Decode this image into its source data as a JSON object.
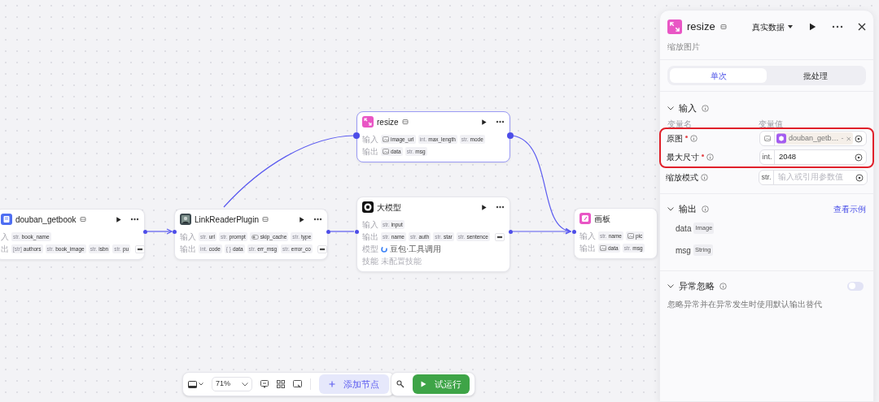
{
  "canvas": {
    "nodes": [
      {
        "title": "douban_getbook",
        "badge": true,
        "selected": false,
        "actions": true,
        "rows": [
          {
            "kind": "chips",
            "label": "入",
            "chips": [
              {
                "kind": "text",
                "type": "str.",
                "name": "book_name"
              }
            ],
            "more": false
          },
          {
            "kind": "chips",
            "label": "出",
            "chips": [
              {
                "kind": "text",
                "type": "[str]",
                "name": "authors"
              },
              {
                "kind": "text",
                "type": "str.",
                "name": "book_image"
              },
              {
                "kind": "text",
                "type": "str.",
                "name": "isbn"
              },
              {
                "kind": "text",
                "type": "str.",
                "name": "pu"
              }
            ],
            "more": true
          }
        ]
      },
      {
        "title": "LinkReaderPlugin",
        "badge": true,
        "selected": false,
        "actions": true,
        "rows": [
          {
            "kind": "chips",
            "label": "输入",
            "chips": [
              {
                "kind": "text",
                "type": "str.",
                "name": "url"
              },
              {
                "kind": "text",
                "type": "str.",
                "name": "prompt"
              },
              {
                "kind": "toggle",
                "name": "skip_cache"
              },
              {
                "kind": "text",
                "type": "str.",
                "name": "type"
              }
            ],
            "more": false
          },
          {
            "kind": "chips",
            "label": "输出",
            "chips": [
              {
                "kind": "text",
                "type": "int.",
                "name": "code"
              },
              {
                "kind": "text",
                "type": "{ }",
                "name": "data"
              },
              {
                "kind": "text",
                "type": "str.",
                "name": "err_msg"
              },
              {
                "kind": "text",
                "type": "str.",
                "name": "error_co"
              }
            ],
            "more": true
          }
        ]
      },
      {
        "title": "resize",
        "badge": true,
        "selected": true,
        "actions": true,
        "rows": [
          {
            "kind": "chips",
            "label": "输入",
            "chips": [
              {
                "kind": "image",
                "name": "image_url"
              },
              {
                "kind": "text",
                "type": "int.",
                "name": "max_length"
              },
              {
                "kind": "text",
                "type": "str.",
                "name": "mode"
              }
            ],
            "more": false
          },
          {
            "kind": "chips",
            "label": "输出",
            "chips": [
              {
                "kind": "image",
                "name": "data"
              },
              {
                "kind": "text",
                "type": "str.",
                "name": "msg"
              }
            ],
            "more": false
          }
        ]
      },
      {
        "title": "大模型",
        "badge": false,
        "selected": false,
        "actions": true,
        "rows": [
          {
            "kind": "chips",
            "label": "输入",
            "chips": [
              {
                "kind": "text",
                "type": "str.",
                "name": "input"
              }
            ],
            "more": false
          },
          {
            "kind": "chips",
            "label": "输出",
            "chips": [
              {
                "kind": "text",
                "type": "str.",
                "name": "name"
              },
              {
                "kind": "text",
                "type": "str.",
                "name": "auth"
              },
              {
                "kind": "text",
                "type": "str.",
                "name": "star"
              },
              {
                "kind": "text",
                "type": "str.",
                "name": "sentence"
              }
            ],
            "more": true
          },
          {
            "kind": "model",
            "label": "模型",
            "value": "豆包·工具调用"
          },
          {
            "kind": "text",
            "label": "技能",
            "value": "未配置技能"
          }
        ]
      },
      {
        "title": "画板",
        "badge": false,
        "selected": false,
        "actions": false,
        "rows": [
          {
            "kind": "chips",
            "label": "输入",
            "chips": [
              {
                "kind": "text",
                "type": "str.",
                "name": "name"
              },
              {
                "kind": "image",
                "name": "pic"
              }
            ],
            "more": false
          },
          {
            "kind": "chips",
            "label": "输出",
            "chips": [
              {
                "kind": "image",
                "name": "data"
              },
              {
                "kind": "text",
                "type": "str.",
                "name": "msg"
              }
            ],
            "more": false
          }
        ]
      }
    ]
  },
  "toolbar": {
    "zoom": "71%",
    "add_label": "添加节点",
    "run_label": "试运行"
  },
  "panel": {
    "title": "resize",
    "badge": true,
    "data_mode": "真实数据",
    "subtitle": "缩放图片",
    "tabs": [
      {
        "label": "单次",
        "selected": true
      },
      {
        "label": "批处理",
        "selected": false
      }
    ],
    "input_section": {
      "title": "输入",
      "expanded": true,
      "col_name": "变量名",
      "col_value": "变量值",
      "params": [
        {
          "name": "原图",
          "required": true,
          "highlighted": true,
          "kind": "reference",
          "ref": "douban_getb…",
          "suffix": "-"
        },
        {
          "name": "最大尺寸",
          "required": true,
          "highlighted": true,
          "kind": "value",
          "type": "int.",
          "value": "2048"
        },
        {
          "name": "缩放模式",
          "required": false,
          "highlighted": false,
          "kind": "value",
          "type": "str.",
          "placeholder": "输入或引用参数值"
        }
      ]
    },
    "output_section": {
      "title": "输出",
      "expanded": true,
      "link": "查看示例",
      "outputs": [
        {
          "name": "data",
          "type": "Image"
        },
        {
          "name": "msg",
          "type": "String"
        }
      ]
    },
    "error_section": {
      "title": "异常忽略",
      "expanded": true,
      "on": false,
      "description": "忽略异常并在异常发生时使用默认输出替代"
    }
  }
}
